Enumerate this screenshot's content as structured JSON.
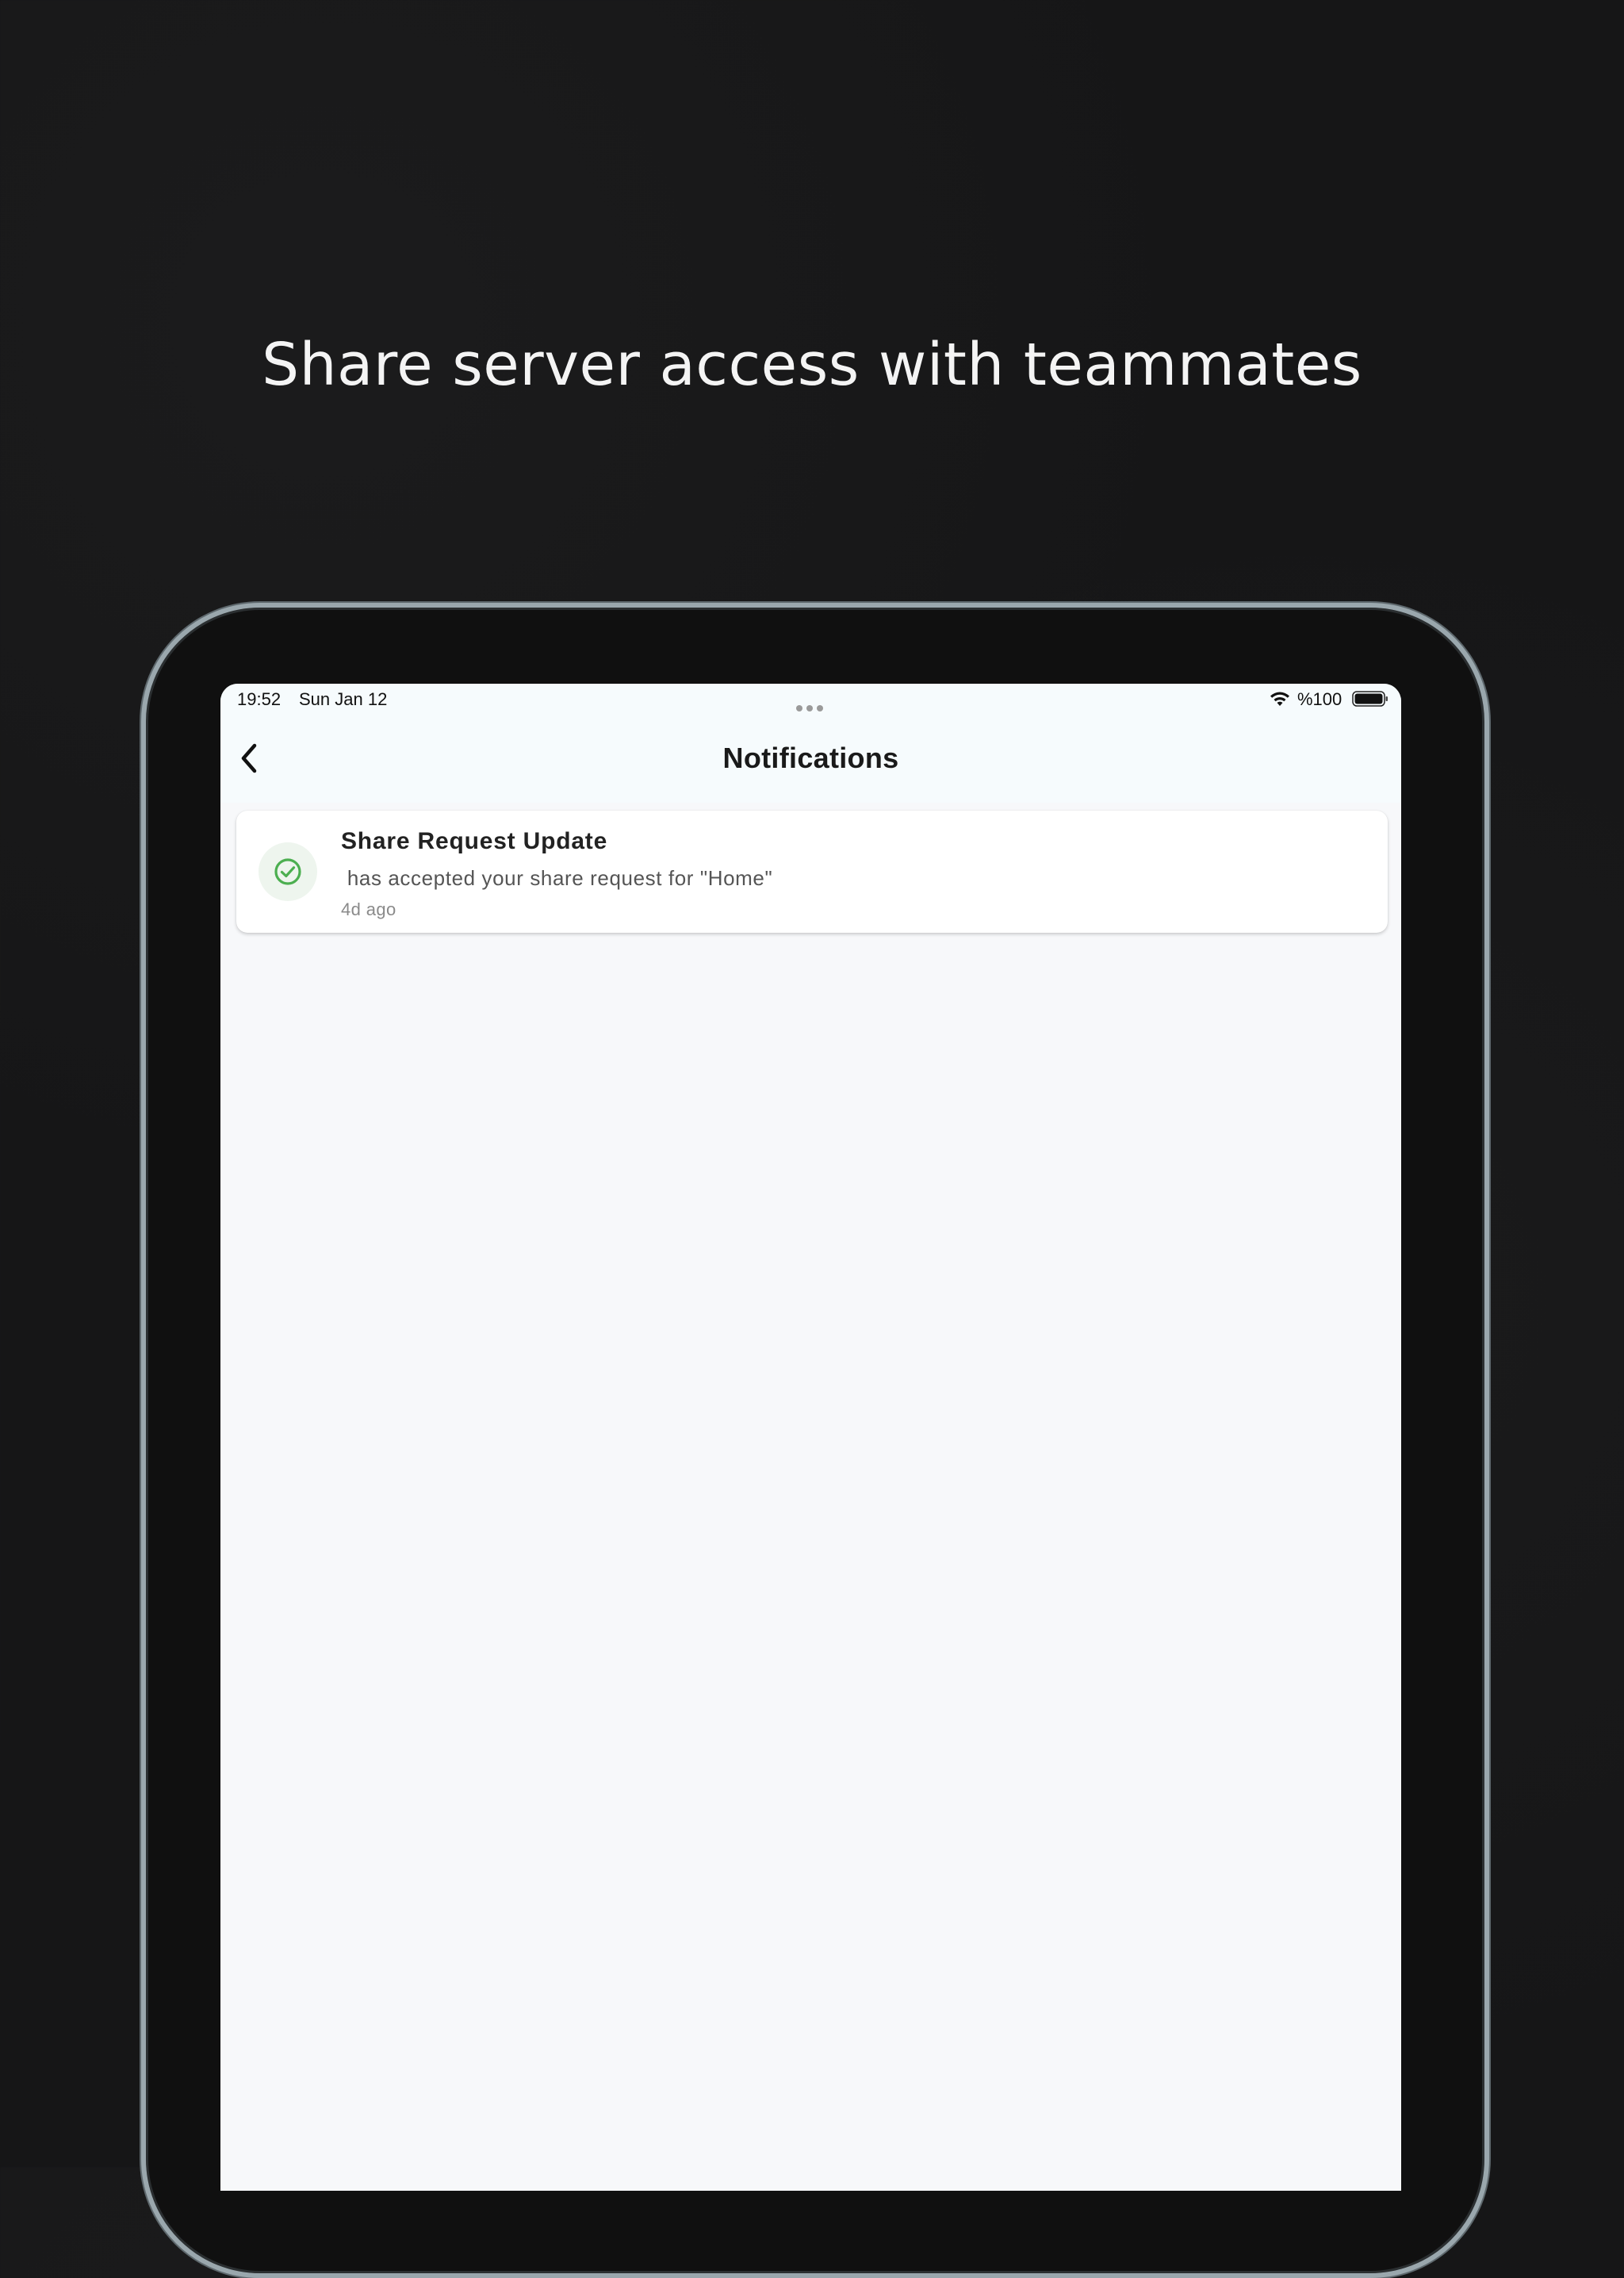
{
  "headline": "Share server access with teammates",
  "status_bar": {
    "time": "19:52",
    "date": "Sun Jan 12",
    "battery": "%100",
    "wifi_icon": "wifi-icon",
    "battery_icon": "battery-icon"
  },
  "nav": {
    "title": "Notifications",
    "back_icon": "chevron-left-icon"
  },
  "notifications": [
    {
      "title": "Share Request Update",
      "body": " has accepted your share request for \"Home\"",
      "time": "4d ago",
      "icon": "check-circle-icon",
      "icon_color": "#4caf50"
    }
  ],
  "colors": {
    "background": "#161617",
    "screen": "#f7f8fa",
    "header": "#f6fbfd",
    "accent_success": "#4caf50"
  }
}
